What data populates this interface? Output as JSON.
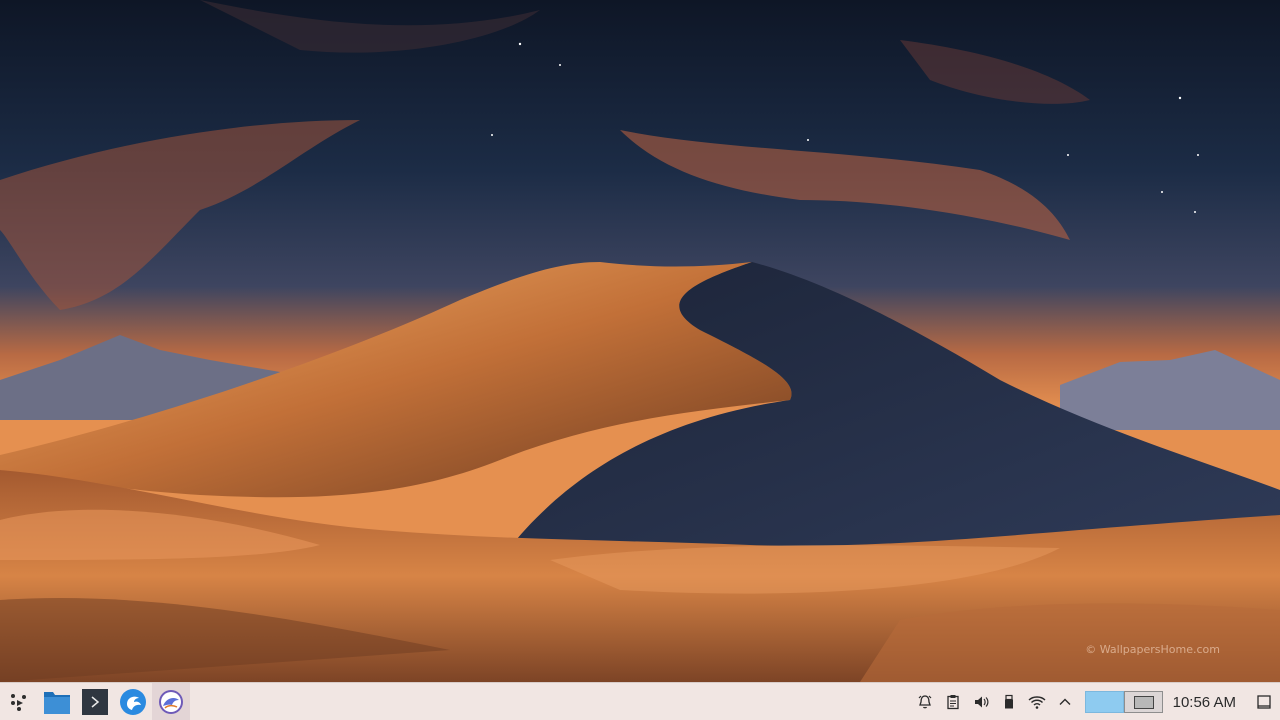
{
  "wallpaper": {
    "watermark": "© WallpapersHome.com"
  },
  "taskbar": {
    "launchers": [
      {
        "name": "application-launcher-icon"
      },
      {
        "name": "file-manager-icon"
      },
      {
        "name": "terminal-icon"
      },
      {
        "name": "web-browser-icon"
      },
      {
        "name": "store-app-icon",
        "active": true
      }
    ],
    "tray": {
      "clock": "10:56 AM"
    }
  },
  "colors": {
    "taskbar_bg": "#f1e6e3",
    "pager_active": "#8ecbf0",
    "file_manager_blue": "#3d8fd6"
  }
}
